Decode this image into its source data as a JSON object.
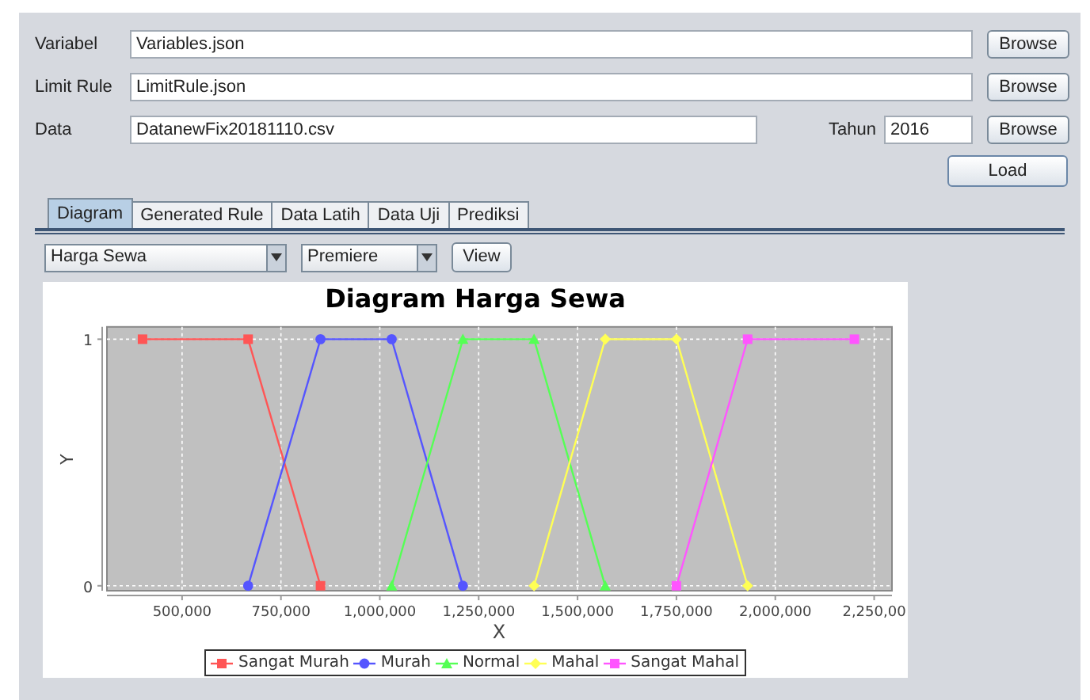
{
  "form": {
    "rows": [
      {
        "label": "Variabel",
        "value": "Variables.json",
        "button": "Browse"
      },
      {
        "label": "Limit Rule",
        "value": "LimitRule.json",
        "button": "Browse"
      },
      {
        "label": "Data",
        "value": "DatanewFix20181110.csv",
        "year_label": "Tahun",
        "year": "2016",
        "button": "Browse"
      }
    ],
    "load_button": "Load"
  },
  "tabs": [
    {
      "label": "Diagram",
      "selected": true
    },
    {
      "label": "Generated Rule",
      "selected": false
    },
    {
      "label": "Data Latih",
      "selected": false
    },
    {
      "label": "Data Uji",
      "selected": false
    },
    {
      "label": "Prediksi",
      "selected": false
    }
  ],
  "controls": {
    "variable": "Harga Sewa",
    "type": "Premiere",
    "view_button": "View"
  },
  "chart": {
    "chart_data": {
      "type": "line",
      "title": "Diagram Harga Sewa",
      "xlabel": "X",
      "ylabel": "Y",
      "xlim": [
        310000,
        2295000
      ],
      "ylim": [
        -0.02,
        1.05
      ],
      "xticks": [
        {
          "value": 500000,
          "label": "500,000"
        },
        {
          "value": 750000,
          "label": "750,000"
        },
        {
          "value": 1000000,
          "label": "1,000,000"
        },
        {
          "value": 1250000,
          "label": "1,250,000"
        },
        {
          "value": 1500000,
          "label": "1,500,000"
        },
        {
          "value": 1750000,
          "label": "1,750,000"
        },
        {
          "value": 2000000,
          "label": "2,000,000"
        },
        {
          "value": 2250000,
          "label": "2,250,00"
        }
      ],
      "grid": true,
      "legend": "bottom",
      "yticks": [
        0,
        1
      ],
      "series": [
        {
          "name": "Sangat Murah",
          "color": "#ff5555",
          "marker": "square",
          "x": [
            400000,
            667000,
            850000
          ],
          "values": [
            1,
            1,
            0
          ]
        },
        {
          "name": "Murah",
          "color": "#5555ff",
          "marker": "circle",
          "x": [
            667000,
            850000,
            1030000,
            1210000
          ],
          "values": [
            0,
            1,
            1,
            0
          ]
        },
        {
          "name": "Normal",
          "color": "#55ff55",
          "marker": "triangle",
          "x": [
            1030000,
            1210000,
            1390000,
            1570000
          ],
          "values": [
            0,
            1,
            1,
            0
          ]
        },
        {
          "name": "Mahal",
          "color": "#ffff55",
          "marker": "diamond",
          "x": [
            1390000,
            1570000,
            1750000,
            1930000
          ],
          "values": [
            0,
            1,
            1,
            0
          ]
        },
        {
          "name": "Sangat Mahal",
          "color": "#ff55ff",
          "marker": "square",
          "x": [
            1750000,
            1930000,
            2200000
          ],
          "values": [
            0,
            1,
            1
          ]
        }
      ]
    }
  }
}
